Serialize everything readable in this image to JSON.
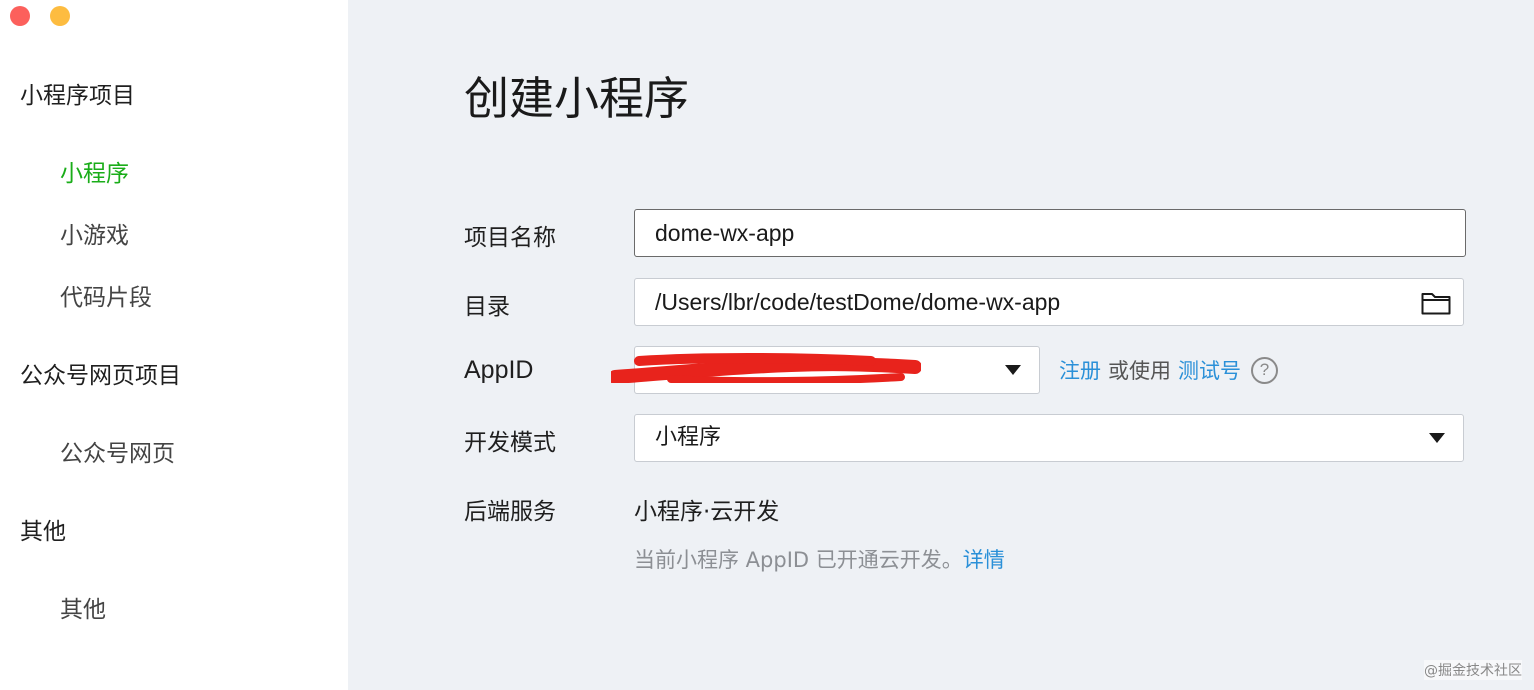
{
  "sidebar": {
    "categories": [
      {
        "label": "小程序项目",
        "items": [
          {
            "label": "小程序",
            "active": true
          },
          {
            "label": "小游戏"
          },
          {
            "label": "代码片段"
          }
        ]
      },
      {
        "label": "公众号网页项目",
        "items": [
          {
            "label": "公众号网页"
          }
        ]
      },
      {
        "label": "其他",
        "items": [
          {
            "label": "其他"
          }
        ]
      }
    ]
  },
  "main": {
    "title": "创建小程序",
    "form": {
      "project_name": {
        "label": "项目名称",
        "value": "dome-wx-app"
      },
      "directory": {
        "label": "目录",
        "value": "/Users/lbr/code/testDome/dome-wx-app"
      },
      "appid": {
        "label": "AppID",
        "register_link": "注册",
        "or_use": "或使用",
        "test_link": "测试号",
        "help": "?"
      },
      "dev_mode": {
        "label": "开发模式",
        "value": "小程序"
      },
      "backend": {
        "label": "后端服务",
        "value": "小程序·云开发",
        "note": "当前小程序 AppID 已开通云开发。",
        "details_link": "详情"
      }
    }
  },
  "watermark": "@掘金技术社区",
  "colors": {
    "accent_green": "#1aad19",
    "link_blue": "#2a90d8",
    "redaction": "#e8231c"
  }
}
